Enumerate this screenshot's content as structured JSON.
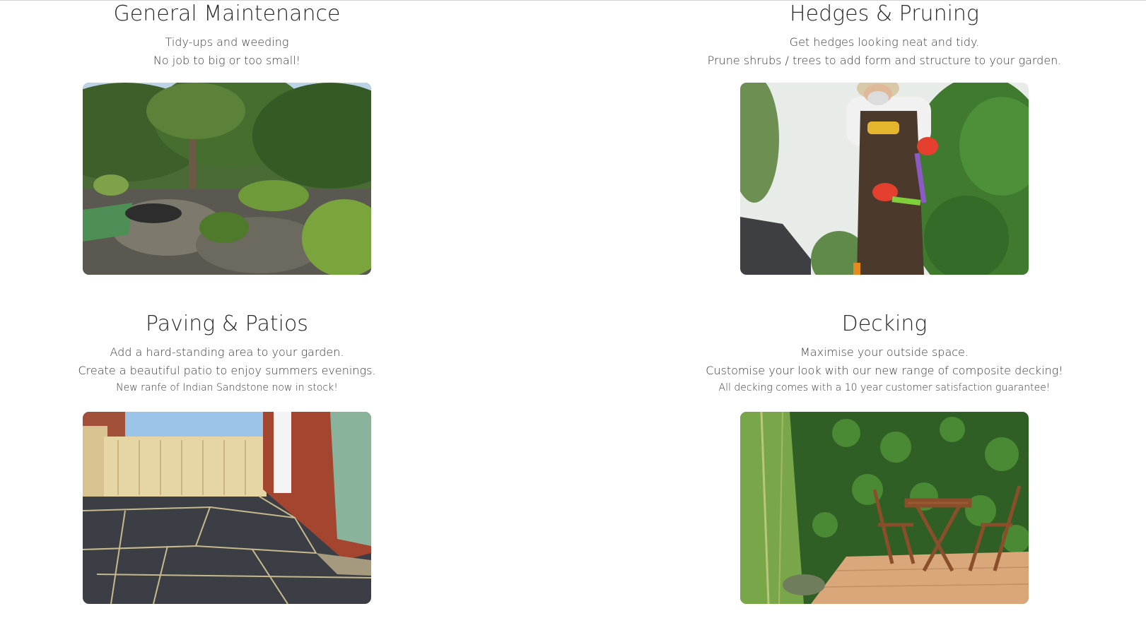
{
  "services": [
    {
      "title": "General Maintenance",
      "lines": [
        "Tidy-ups and weeding",
        "No job to big or too small!"
      ],
      "note": "",
      "image": "garden-rockery-photo"
    },
    {
      "title": "Hedges & Pruning",
      "lines": [
        "Get hedges looking neat and tidy.",
        "Prune shrubs / trees to add form and structure to your garden."
      ],
      "note": "",
      "image": "gardener-trimming-hedge-photo"
    },
    {
      "title": "Paving & Patios",
      "lines": [
        "Add a hard-standing area to your garden.",
        "Create a beautiful patio to enjoy summers evenings."
      ],
      "note": "New ranfe of Indian Sandstone now in stock!",
      "image": "slate-patio-photo"
    },
    {
      "title": "Decking",
      "lines": [
        "Maximise your outside space.",
        "Customise your look with our new range of composite decking!"
      ],
      "note": "All decking comes with a 10 year customer satisfaction guarantee!",
      "image": "deck-bistro-set-photo"
    }
  ],
  "colors": {
    "text": "#2a2a2a",
    "foliage": "#3f6b2a",
    "brick": "#a0452e",
    "slate": "#3a3d42",
    "deck": "#d9a77a"
  }
}
